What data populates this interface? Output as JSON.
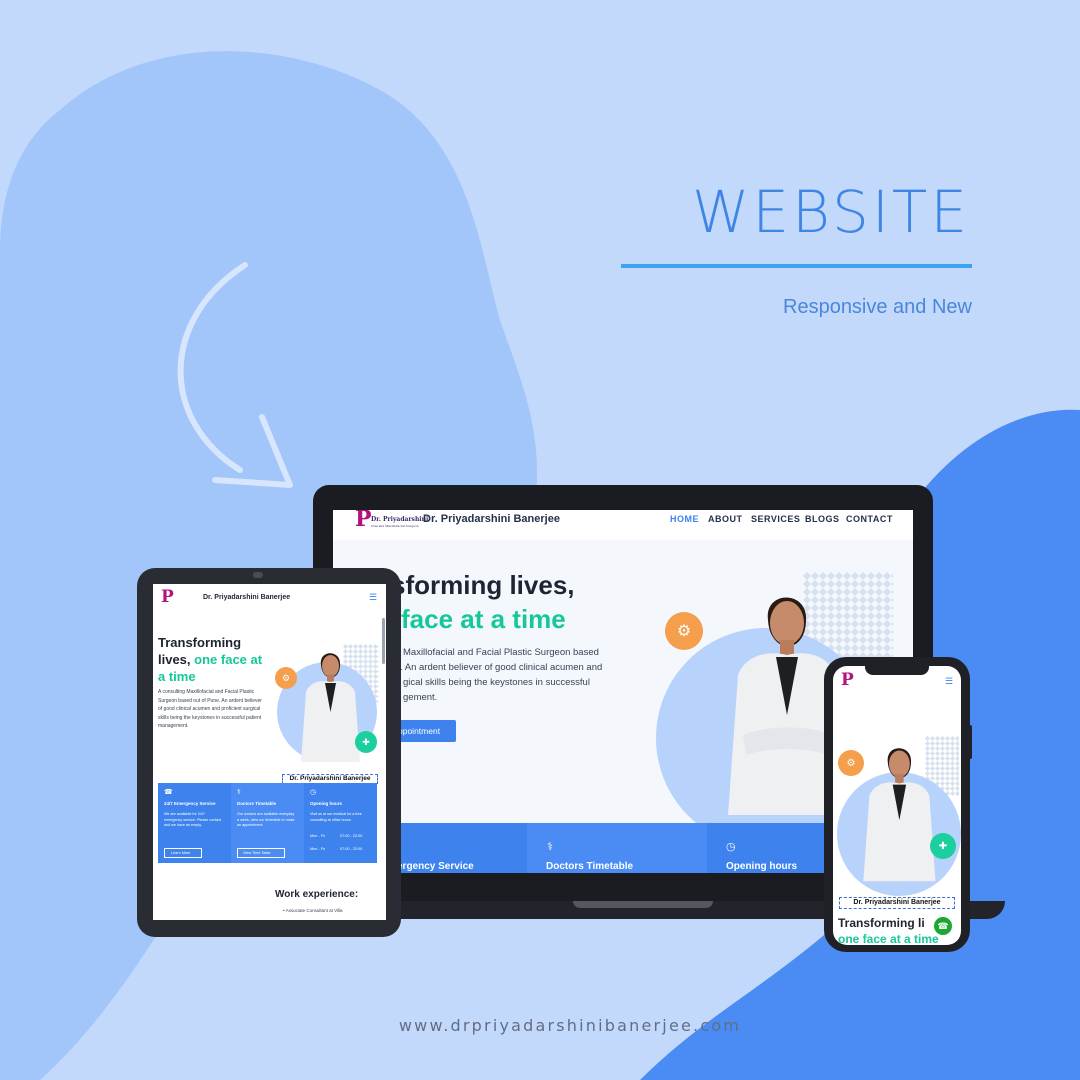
{
  "headline": "WEBSITE",
  "subline": "Responsive and New",
  "footer_url": "www.drpriyadarshinibanerjee.com",
  "colors": {
    "background": "#c3d9fb",
    "accent_blue": "#3f86e4",
    "brand_green": "#16c79a",
    "orange": "#f59e4b",
    "service_blue": "#3e82ee"
  },
  "laptop": {
    "brand": "Dr. Priyadarshini Banerjee",
    "logo_line1": "Dr. Priyadarshini",
    "logo_line2": "Oral and Maxillofacial Surgeon",
    "nav": [
      "HOME",
      "ABOUT",
      "SERVICES",
      "BLOGS",
      "CONTACT"
    ],
    "hero_line1": "sforming lives,",
    "hero_line2": "face at a time",
    "hero_body": [
      "Maxillofacial and Facial Plastic Surgeon based",
      ". An ardent believer of good clinical acumen and",
      "gical skills being the keystones in successful",
      "gement."
    ],
    "cta": "ppointment",
    "services": [
      "ergency Service",
      "Doctors Timetable",
      "Opening hours"
    ]
  },
  "tablet": {
    "brand": "Dr. Priyadarshini Banerjee",
    "hero_line1": "Transforming",
    "hero_line2a": "lives,",
    "hero_line2b": "one face at",
    "hero_line3": "a time",
    "hero_body": "A consulting Maxillofacial and Facial Plastic Surgeon based out of Pune. An ardent believer of good clinical acumen and proficient surgical skills being the keystones in successful patient management.",
    "name_tag": "Dr. Priyadarshini Banerjee",
    "services": [
      {
        "title": "24/7 Emergency Service",
        "text": "We are available for 24/7 emergency service. Please contact and we have an empty.",
        "button": "Learn More"
      },
      {
        "title": "Doctors Timetable",
        "text": "Our doctors are available everyday a week, view our timetable to make an appointment.",
        "button": "View Time Table"
      },
      {
        "title": "Opening hours",
        "text": "Visit us at our medical for a free consulting at office hours.",
        "row1_day": "Mon - Fri",
        "row1_time": "07:00 - 22:00",
        "row2_day": "Mon - Fri",
        "row2_time": "07:00 - 22:00"
      }
    ],
    "work_title": "Work experience:",
    "work_item": "Associate Consultant at Villa"
  },
  "phone": {
    "name_tag": "Dr. Priyadarshini Banerjee",
    "hero_line1": "Transforming li",
    "hero_line2": "one face at a time"
  }
}
